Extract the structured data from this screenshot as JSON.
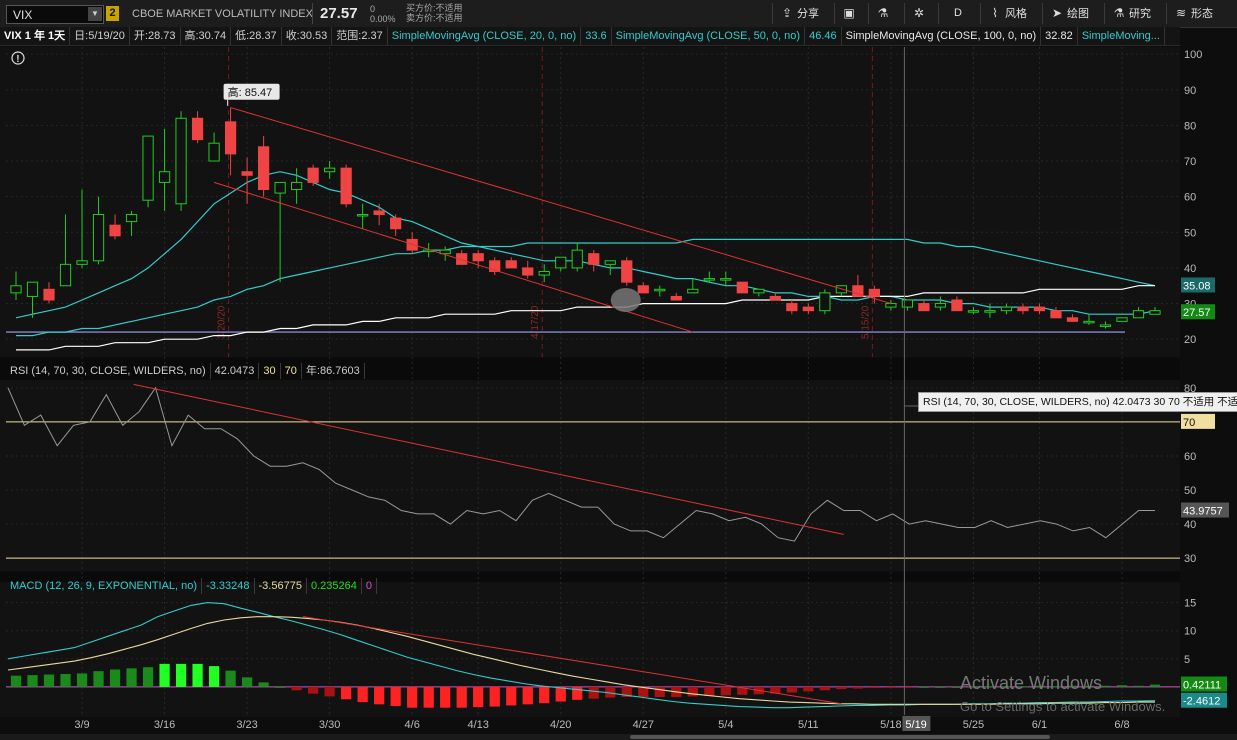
{
  "toolbar": {
    "symbol": "VIX",
    "link_number": "2",
    "instrument_name": "CBOE MARKET VOLATILITY INDEX",
    "last_price": "27.57",
    "net_change": "0",
    "pct_change": "0.00%",
    "bid_label": "买方价:不适用",
    "ask_label": "卖方价:不适用",
    "share_label": "分享",
    "period_label": "D",
    "style_label": "风格",
    "drawing_label": "绘图",
    "studies_label": "研究",
    "patterns_label": "形态"
  },
  "infobar": {
    "header": "VIX 1 年 1天",
    "date": "日:5/19/20",
    "open": "开:28.73",
    "high": "高:30.74",
    "low": "低:28.37",
    "close": "收:30.53",
    "range": "范围:2.37",
    "sma20_label": "SimpleMovingAvg (CLOSE, 20, 0, no)",
    "sma20_value": "33.6",
    "sma50_label": "SimpleMovingAvg (CLOSE, 50, 0, no)",
    "sma50_value": "46.46",
    "sma100_label": "SimpleMovingAvg (CLOSE, 100, 0, no)",
    "sma100_value": "32.82",
    "sma_extra_label": "SimpleMoving..."
  },
  "price_panel": {
    "high_label": "高: 85.47",
    "price_tags": {
      "sma": "35.08",
      "last": "27.57"
    },
    "event_labels": [
      "3/20/20",
      "4/17/20",
      "5/15/20"
    ]
  },
  "rsi_panel": {
    "label": "RSI (14, 70, 30, CLOSE, WILDERS, no)",
    "value": "42.0473",
    "oversold": "30",
    "overbought": "70",
    "extra": "年:86.7603",
    "tooltip": "RSI (14, 70, 30, CLOSE, WILDERS, no) 42.0473 30 70 不适用 不适用",
    "tag_70": "70",
    "tag_value": "43.9757"
  },
  "macd_panel": {
    "label": "MACD (12, 26, 9, EXPONENTIAL, no)",
    "value": "-3.33248",
    "avg": "-3.56775",
    "diff": "0.235264",
    "zero": "0",
    "tag_a": "0.42111",
    "tag_b": "-2.4612"
  },
  "cursor_date": "5/19",
  "watermark": {
    "line1": "Activate Windows",
    "line2": "Go to Settings to activate Windows."
  },
  "colors": {
    "up": "#22cc22",
    "down": "#ee4444",
    "sma20": "#33cccc",
    "sma100": "#ffffff",
    "trend": "#dd3333",
    "rsi": "#999999",
    "macd_fast": "#33cccc",
    "macd_slow": "#e8d9a0"
  },
  "chart_data": [
    {
      "type": "candlestick",
      "title": "VIX 1 年 1天",
      "ylim": [
        15,
        102
      ],
      "yticks": [
        20,
        30,
        40,
        50,
        60,
        70,
        80,
        90,
        100
      ],
      "xticks": [
        "3/9",
        "3/16",
        "3/23",
        "3/30",
        "4/6",
        "4/13",
        "4/20",
        "4/27",
        "5/4",
        "5/11",
        "5/18",
        "5/25",
        "6/1",
        "6/8"
      ],
      "candles": [
        {
          "d": "3/3",
          "o": 33,
          "h": 39,
          "l": 31,
          "c": 35
        },
        {
          "d": "3/4",
          "o": 32,
          "h": 36,
          "l": 26,
          "c": 36
        },
        {
          "d": "3/5",
          "o": 34,
          "h": 36,
          "l": 30,
          "c": 31
        },
        {
          "d": "3/6",
          "o": 35,
          "h": 55,
          "l": 35,
          "c": 41
        },
        {
          "d": "3/9",
          "o": 41,
          "h": 62,
          "l": 40,
          "c": 42
        },
        {
          "d": "3/10",
          "o": 42,
          "h": 60,
          "l": 41,
          "c": 55
        },
        {
          "d": "3/11",
          "o": 52,
          "h": 55,
          "l": 48,
          "c": 49
        },
        {
          "d": "3/12",
          "o": 53,
          "h": 56,
          "l": 49,
          "c": 55
        },
        {
          "d": "3/13",
          "o": 59,
          "h": 76,
          "l": 57,
          "c": 77
        },
        {
          "d": "3/16",
          "o": 64,
          "h": 79,
          "l": 56,
          "c": 67
        },
        {
          "d": "3/17",
          "o": 58,
          "h": 84,
          "l": 56,
          "c": 82
        },
        {
          "d": "3/18",
          "o": 82,
          "h": 84,
          "l": 75,
          "c": 76
        },
        {
          "d": "3/19",
          "o": 70,
          "h": 78,
          "l": 70,
          "c": 75
        },
        {
          "d": "3/20",
          "o": 81,
          "h": 85,
          "l": 66,
          "c": 72
        },
        {
          "d": "3/23",
          "o": 67,
          "h": 71,
          "l": 58,
          "c": 66
        },
        {
          "d": "3/24",
          "o": 74,
          "h": 77,
          "l": 60,
          "c": 62
        },
        {
          "d": "3/25",
          "o": 61,
          "h": 63,
          "l": 36,
          "c": 64
        },
        {
          "d": "3/26",
          "o": 62,
          "h": 68,
          "l": 58,
          "c": 64
        },
        {
          "d": "3/27",
          "o": 68,
          "h": 69,
          "l": 63,
          "c": 64
        },
        {
          "d": "3/30",
          "o": 67,
          "h": 70,
          "l": 65,
          "c": 68
        },
        {
          "d": "3/31",
          "o": 68,
          "h": 69,
          "l": 57,
          "c": 58
        },
        {
          "d": "4/1",
          "o": 55,
          "h": 58,
          "l": 51,
          "c": 55
        },
        {
          "d": "4/2",
          "o": 56,
          "h": 58,
          "l": 52,
          "c": 55
        },
        {
          "d": "4/3",
          "o": 54,
          "h": 55,
          "l": 49,
          "c": 51
        },
        {
          "d": "4/6",
          "o": 48,
          "h": 50,
          "l": 44,
          "c": 45
        },
        {
          "d": "4/7",
          "o": 45,
          "h": 47,
          "l": 43,
          "c": 45
        },
        {
          "d": "4/8",
          "o": 44,
          "h": 46,
          "l": 42,
          "c": 45
        },
        {
          "d": "4/9",
          "o": 44,
          "h": 45,
          "l": 41,
          "c": 41
        },
        {
          "d": "4/13",
          "o": 44,
          "h": 45,
          "l": 40,
          "c": 42
        },
        {
          "d": "4/14",
          "o": 42,
          "h": 43,
          "l": 38,
          "c": 39
        },
        {
          "d": "4/15",
          "o": 42,
          "h": 43,
          "l": 40,
          "c": 40
        },
        {
          "d": "4/16",
          "o": 40,
          "h": 42,
          "l": 37,
          "c": 38
        },
        {
          "d": "4/17",
          "o": 38,
          "h": 41,
          "l": 36,
          "c": 39
        },
        {
          "d": "4/20",
          "o": 40,
          "h": 43,
          "l": 39,
          "c": 43
        },
        {
          "d": "4/21",
          "o": 40,
          "h": 47,
          "l": 39,
          "c": 45
        },
        {
          "d": "4/22",
          "o": 44,
          "h": 45,
          "l": 39,
          "c": 41
        },
        {
          "d": "4/23",
          "o": 41,
          "h": 42,
          "l": 38,
          "c": 42
        },
        {
          "d": "4/24",
          "o": 42,
          "h": 43,
          "l": 35,
          "c": 36
        },
        {
          "d": "4/27",
          "o": 35,
          "h": 36,
          "l": 33,
          "c": 33
        },
        {
          "d": "4/28",
          "o": 34,
          "h": 35,
          "l": 32,
          "c": 34
        },
        {
          "d": "4/29",
          "o": 32,
          "h": 33,
          "l": 31,
          "c": 31
        },
        {
          "d": "4/30",
          "o": 33,
          "h": 37,
          "l": 33,
          "c": 34
        },
        {
          "d": "5/1",
          "o": 37,
          "h": 39,
          "l": 36,
          "c": 37
        },
        {
          "d": "5/4",
          "o": 37,
          "h": 39,
          "l": 35,
          "c": 37
        },
        {
          "d": "5/5",
          "o": 36,
          "h": 36,
          "l": 33,
          "c": 33
        },
        {
          "d": "5/6",
          "o": 33,
          "h": 34,
          "l": 32,
          "c": 34
        },
        {
          "d": "5/7",
          "o": 32,
          "h": 33,
          "l": 31,
          "c": 31
        },
        {
          "d": "5/8",
          "o": 30,
          "h": 31,
          "l": 27,
          "c": 28
        },
        {
          "d": "5/11",
          "o": 29,
          "h": 30,
          "l": 27,
          "c": 28
        },
        {
          "d": "5/12",
          "o": 28,
          "h": 34,
          "l": 27,
          "c": 33
        },
        {
          "d": "5/13",
          "o": 33,
          "h": 35,
          "l": 32,
          "c": 35
        },
        {
          "d": "5/14",
          "o": 35,
          "h": 38,
          "l": 32,
          "c": 32
        },
        {
          "d": "5/15",
          "o": 34,
          "h": 35,
          "l": 30,
          "c": 32
        },
        {
          "d": "5/18",
          "o": 29,
          "h": 31,
          "l": 28,
          "c": 30
        },
        {
          "d": "5/19",
          "o": 29,
          "h": 31,
          "l": 28,
          "c": 31
        },
        {
          "d": "5/20",
          "o": 30,
          "h": 31,
          "l": 28,
          "c": 28
        },
        {
          "d": "5/21",
          "o": 29,
          "h": 32,
          "l": 28,
          "c": 30
        },
        {
          "d": "5/22",
          "o": 31,
          "h": 32,
          "l": 28,
          "c": 28
        },
        {
          "d": "5/26",
          "o": 28,
          "h": 29,
          "l": 27,
          "c": 28
        },
        {
          "d": "5/27",
          "o": 28,
          "h": 30,
          "l": 26,
          "c": 28
        },
        {
          "d": "5/28",
          "o": 28,
          "h": 30,
          "l": 27,
          "c": 29
        },
        {
          "d": "5/29",
          "o": 29,
          "h": 30,
          "l": 27,
          "c": 28
        },
        {
          "d": "6/1",
          "o": 29,
          "h": 30,
          "l": 27,
          "c": 28
        },
        {
          "d": "6/2",
          "o": 28,
          "h": 29,
          "l": 26,
          "c": 26
        },
        {
          "d": "6/3",
          "o": 26,
          "h": 27,
          "l": 25,
          "c": 25
        },
        {
          "d": "6/4",
          "o": 25,
          "h": 27,
          "l": 24,
          "c": 25
        },
        {
          "d": "6/5",
          "o": 24,
          "h": 25,
          "l": 23,
          "c": 24
        },
        {
          "d": "6/8",
          "o": 25,
          "h": 26,
          "l": 25,
          "c": 26
        },
        {
          "d": "6/9",
          "o": 26,
          "h": 29,
          "l": 26,
          "c": 28
        },
        {
          "d": "6/10",
          "o": 27,
          "h": 29,
          "l": 27,
          "c": 28
        }
      ],
      "series": [
        {
          "name": "SimpleMovingAvg (CLOSE, 20, 0, no)",
          "values": [
            26,
            27,
            28,
            29,
            31,
            33,
            35,
            37,
            40,
            44,
            48,
            53,
            58,
            61,
            64,
            66,
            67,
            66,
            64,
            62,
            61,
            59,
            57,
            54,
            53,
            51,
            49,
            47,
            46,
            45,
            44,
            43,
            42,
            42,
            42,
            41,
            40,
            40,
            39,
            38,
            37,
            37,
            36,
            35,
            35,
            34,
            33,
            33,
            32,
            32,
            31,
            31,
            32,
            32,
            31,
            31,
            31,
            30,
            30,
            29,
            29,
            29,
            29,
            28,
            28,
            27,
            27,
            27,
            27,
            28
          ]
        },
        {
          "name": "SimpleMovingAvg (CLOSE, 50, 0, no)",
          "values": [
            21,
            21,
            22,
            22,
            23,
            23,
            24,
            25,
            26,
            27,
            28,
            29,
            31,
            32,
            34,
            35,
            37,
            38,
            39,
            40,
            41,
            42,
            43,
            44,
            44,
            45,
            45,
            46,
            46,
            46,
            46,
            47,
            47,
            47,
            47,
            47,
            47,
            47,
            47,
            47,
            47,
            48,
            48,
            48,
            48,
            48,
            48,
            48,
            48,
            48,
            48,
            48,
            48,
            48,
            48,
            47,
            47,
            46,
            46,
            45,
            44,
            43,
            42,
            41,
            40,
            39,
            38,
            37,
            36,
            35
          ]
        },
        {
          "name": "SimpleMovingAvg (CLOSE, 100, 0, no)",
          "values": [
            17,
            17,
            17,
            18,
            18,
            18,
            19,
            19,
            19,
            20,
            20,
            20,
            21,
            21,
            22,
            22,
            23,
            23,
            24,
            24,
            24,
            25,
            25,
            26,
            26,
            26,
            27,
            27,
            27,
            27,
            28,
            28,
            28,
            28,
            29,
            29,
            29,
            29,
            30,
            30,
            30,
            30,
            30,
            30,
            31,
            31,
            31,
            31,
            31,
            32,
            32,
            32,
            32,
            32,
            32,
            33,
            33,
            33,
            33,
            33,
            33,
            33,
            34,
            34,
            34,
            34,
            34,
            34,
            35,
            35
          ]
        }
      ]
    },
    {
      "type": "line",
      "title": "RSI (14, 70, 30, CLOSE, WILDERS, no)",
      "ylim": [
        28,
        82
      ],
      "yticks": [
        30,
        40,
        50,
        60,
        70,
        80
      ],
      "series": [
        {
          "name": "RSI (14, 70, 30, CLOSE, WILDERS, no)",
          "values": [
            80,
            69,
            72,
            63,
            69,
            70,
            78,
            69,
            73,
            80,
            63,
            72,
            68,
            68,
            65,
            60,
            57,
            57,
            58,
            56,
            52,
            50,
            48,
            47,
            44,
            43,
            43,
            40,
            44,
            43,
            44,
            41,
            47,
            49,
            47,
            45,
            45,
            40,
            38,
            38,
            36,
            40,
            44,
            43,
            41,
            42,
            40,
            36,
            35,
            43,
            47,
            44,
            44,
            41,
            43,
            40,
            41,
            40,
            39,
            39,
            41,
            39,
            40,
            41,
            40,
            38,
            39,
            36,
            40,
            44,
            44
          ]
        }
      ]
    },
    {
      "type": "line",
      "title": "MACD (12, 26, 9, EXPONENTIAL, no)",
      "ylim": [
        -5,
        16
      ],
      "yticks": [
        0,
        5,
        10,
        15
      ],
      "series": [
        {
          "name": "MACD (12, 26, 9, EXPONENTIAL, no)",
          "values": [
            5,
            5.5,
            6,
            6.5,
            7,
            8,
            9,
            10,
            11,
            12.5,
            13.5,
            14.5,
            15,
            14.8,
            14,
            13.3,
            12.5,
            11.8,
            11,
            10.2,
            9.3,
            8.3,
            7.3,
            6.3,
            5.3,
            4.5,
            3.7,
            2.9,
            2.2,
            1.6,
            1.1,
            0.6,
            0.2,
            -0.1,
            -0.4,
            -0.7,
            -1,
            -1.4,
            -1.8,
            -2.2,
            -2.6,
            -2.9,
            -3.1,
            -3.3,
            -3.5,
            -3.6,
            -3.7,
            -3.7,
            -3.6,
            -3.5,
            -3.4,
            -3.3,
            -3.3,
            -3.2,
            -3.2,
            -3.1,
            -3.1,
            -3.1,
            -3,
            -3,
            -2.9,
            -2.9,
            -2.8,
            -2.8,
            -2.7,
            -2.7,
            -2.6,
            -2.5,
            -2.5,
            -2.46
          ]
        },
        {
          "name": "MACD Avg",
          "values": [
            3,
            3.4,
            3.8,
            4.2,
            4.6,
            5.2,
            5.9,
            6.7,
            7.5,
            8.4,
            9.4,
            10.4,
            11.3,
            11.9,
            12.3,
            12.5,
            12.5,
            12.4,
            12.2,
            11.9,
            11.5,
            11,
            10.4,
            9.7,
            9,
            8.2,
            7.4,
            6.6,
            5.8,
            5.1,
            4.4,
            3.7,
            3.1,
            2.5,
            1.9,
            1.4,
            0.9,
            0.4,
            0,
            -0.4,
            -0.8,
            -1.2,
            -1.5,
            -1.8,
            -2.1,
            -2.3,
            -2.5,
            -2.7,
            -2.8,
            -2.9,
            -3,
            -3,
            -3.1,
            -3.1,
            -3.1,
            -3.1,
            -3.1,
            -3.1,
            -3.1,
            -3.1,
            -3,
            -3,
            -3,
            -2.9,
            -2.9,
            -2.9,
            -2.8,
            -2.8,
            -2.7,
            -2.7
          ]
        }
      ],
      "histogram": [
        2,
        2.1,
        2.2,
        2.3,
        2.4,
        2.8,
        3.1,
        3.3,
        3.5,
        4.1,
        4.1,
        4.1,
        3.7,
        2.9,
        1.7,
        0.8,
        0,
        -0.6,
        -1.2,
        -1.7,
        -2.2,
        -2.7,
        -3.1,
        -3.4,
        -3.7,
        -3.7,
        -3.7,
        -3.7,
        -3.6,
        -3.5,
        -3.3,
        -3.1,
        -2.9,
        -2.6,
        -2.3,
        -2.1,
        -1.9,
        -1.8,
        -1.8,
        -1.8,
        -1.8,
        -1.7,
        -1.6,
        -1.5,
        -1.4,
        -1.3,
        -1.2,
        -1,
        -0.8,
        -0.6,
        -0.4,
        -0.3,
        -0.2,
        -0.1,
        -0.1,
        0,
        0,
        0,
        0.1,
        0.1,
        0.1,
        0.1,
        0.2,
        0.1,
        0.2,
        0.2,
        0.2,
        0.3,
        0.2,
        0.4
      ]
    }
  ]
}
